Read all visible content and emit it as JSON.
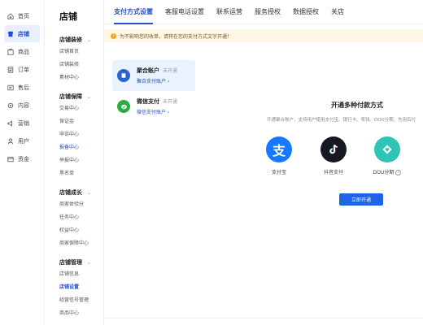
{
  "nav": [
    {
      "label": "首页",
      "icon": "home-icon"
    },
    {
      "label": "店铺",
      "icon": "store-icon",
      "active": true
    },
    {
      "label": "商品",
      "icon": "goods-icon"
    },
    {
      "label": "订单",
      "icon": "order-icon"
    },
    {
      "label": "售后",
      "icon": "aftersale-icon"
    },
    {
      "label": "内容",
      "icon": "content-icon"
    },
    {
      "label": "营销",
      "icon": "marketing-icon"
    },
    {
      "label": "用户",
      "icon": "user-icon"
    },
    {
      "label": "资金",
      "icon": "funds-icon"
    }
  ],
  "submenu": {
    "title": "店铺",
    "groups": [
      {
        "title": "店铺装修",
        "items": [
          "店铺首页",
          "店铺装修",
          "素材中心"
        ]
      },
      {
        "title": "店铺保障",
        "items": [
          "交易中心",
          "保证金",
          "申诉中心",
          "报备中心",
          "举报中心",
          "黑名单"
        ]
      },
      {
        "title": "店铺成长",
        "items": [
          "商家体验分",
          "任务中心",
          "权益中心",
          "商家保障中心"
        ]
      },
      {
        "title": "店铺管理",
        "items": [
          "店铺信息",
          "店铺设置",
          "经营信号管理",
          "商品中心"
        ]
      }
    ],
    "active_item": "店铺设置"
  },
  "tabs": [
    "支付方式设置",
    "客服电话设置",
    "联系运营",
    "服务授权",
    "数据授权",
    "关店"
  ],
  "active_tab": "支付方式设置",
  "notice": "为不影响您的收单，请将在您的支付方式文字开通！",
  "accounts": [
    {
      "name": "聚合账户",
      "status": "未开通",
      "link": "聚合支付账户 ›",
      "selected": true,
      "color": "#2a63d6"
    },
    {
      "name": "微信支付",
      "status": "未开通",
      "link": "微信支付账户 ›",
      "selected": false,
      "color": "#2aae43"
    }
  ],
  "panel": {
    "title": "开通多种付款方式",
    "desc": "开通聚合账户，支持用户使用支付宝、银行卡、零钱、DOU分期、先用后付",
    "methods": [
      {
        "label": "支付宝",
        "icon": "alipay-icon",
        "color": "#1677ff"
      },
      {
        "label": "抖音支付",
        "icon": "douyin-pay-icon",
        "color": "#161823"
      },
      {
        "label": "DOU分期",
        "icon": "dou-installment-icon",
        "color": "#2ec4b6"
      }
    ],
    "button": "立即开通"
  }
}
